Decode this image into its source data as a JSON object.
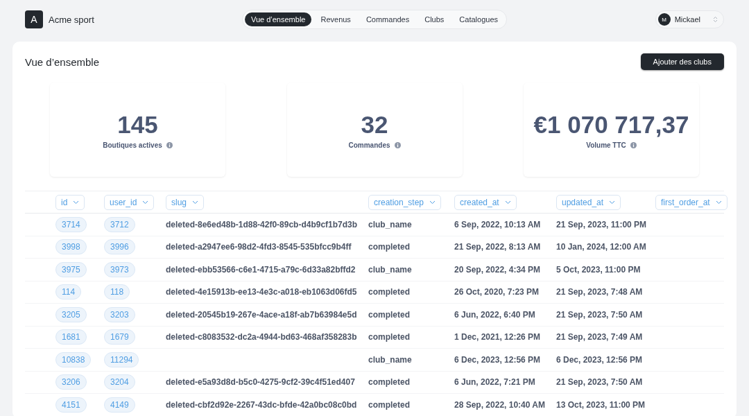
{
  "brand": {
    "logo": "A",
    "name": "Acme sport"
  },
  "nav": [
    {
      "label": "Vue d’ensemble",
      "selected": true
    },
    {
      "label": "Revenus",
      "selected": false
    },
    {
      "label": "Commandes",
      "selected": false
    },
    {
      "label": "Clubs",
      "selected": false
    },
    {
      "label": "Catalogues",
      "selected": false
    }
  ],
  "user": {
    "initial": "M",
    "name": "Mickael"
  },
  "page": {
    "title": "Vue d’ensemble",
    "action": "Ajouter des clubs"
  },
  "stats": [
    {
      "value": "145",
      "label": "Boutiques actives"
    },
    {
      "value": "32",
      "label": "Commandes"
    },
    {
      "value": "€1 070 717,37",
      "label": "Volume TTC"
    }
  ],
  "table": {
    "columns": [
      "id",
      "user_id",
      "slug",
      "creation_step",
      "created_at",
      "updated_at",
      "first_order_at"
    ],
    "rows": [
      [
        "3714",
        "3712",
        "deleted-8e6ed48b-1d88-42f0-89cb-d4b9cf1b7d3b",
        "club_name",
        "6 Sep, 2022, 10:13 AM",
        "21 Sep, 2023, 11:00 PM"
      ],
      [
        "3998",
        "3996",
        "deleted-a2947ee6-98d2-4fd3-8545-535bfcc9b4ff",
        "completed",
        "21 Sep, 2022, 8:13 AM",
        "10 Jan, 2024, 12:00 AM"
      ],
      [
        "3975",
        "3973",
        "deleted-ebb53566-c6e1-4715-a79c-6d33a82bffd2",
        "club_name",
        "20 Sep, 2022, 4:34 PM",
        "5 Oct, 2023, 11:00 PM"
      ],
      [
        "114",
        "118",
        "deleted-4e15913b-ee13-4e3c-a018-eb1063d06fd5",
        "completed",
        "26 Oct, 2020, 7:23 PM",
        "21 Sep, 2023, 7:48 AM"
      ],
      [
        "3205",
        "3203",
        "deleted-20545b19-267e-4ace-a18f-ab7b63984e5d",
        "completed",
        "6 Jun, 2022, 6:40 PM",
        "21 Sep, 2023, 7:50 AM"
      ],
      [
        "1681",
        "1679",
        "deleted-c8083532-dc2a-4944-bd63-468af358283b",
        "completed",
        "1 Dec, 2021, 12:26 PM",
        "21 Sep, 2023, 7:49 AM"
      ],
      [
        "10838",
        "11294",
        "",
        "club_name",
        "6 Dec, 2023, 12:56 PM",
        "6 Dec, 2023, 12:56 PM"
      ],
      [
        "3206",
        "3204",
        "deleted-e5a93d8d-b5c0-4275-9cf2-39c4f51ed407",
        "completed",
        "6 Jun, 2022, 7:21 PM",
        "21 Sep, 2023, 7:50 AM"
      ],
      [
        "4151",
        "4149",
        "deleted-cbf2d92e-2267-43dc-bfde-42a0bc08c0bd",
        "completed",
        "28 Sep, 2022, 10:40 AM",
        "13 Oct, 2023, 11:00 PM"
      ]
    ]
  }
}
